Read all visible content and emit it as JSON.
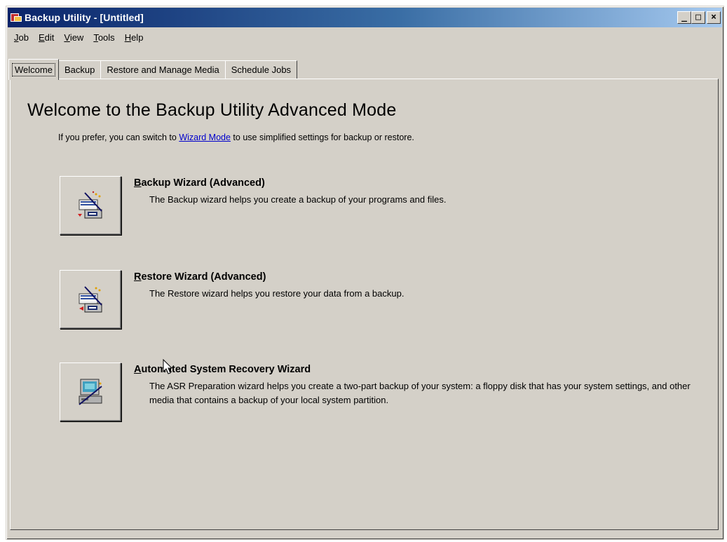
{
  "window": {
    "title": "Backup Utility - [Untitled]",
    "controls": {
      "minimize": "_",
      "maximize": "□",
      "close": "×"
    }
  },
  "menu": [
    {
      "key": "J",
      "rest": "ob"
    },
    {
      "key": "E",
      "rest": "dit"
    },
    {
      "key": "V",
      "rest": "iew"
    },
    {
      "key": "T",
      "rest": "ools"
    },
    {
      "key": "H",
      "rest": "elp"
    }
  ],
  "tabs": [
    "Welcome",
    "Backup",
    "Restore and Manage Media",
    "Schedule Jobs"
  ],
  "welcome": {
    "heading": "Welcome to the Backup Utility Advanced Mode",
    "subtitle_pre": "If you prefer, you can switch to ",
    "subtitle_link": "Wizard Mode",
    "subtitle_post": " to use simplified settings for backup or restore."
  },
  "wizards": [
    {
      "title_key": "B",
      "title_rest": "ackup Wizard (Advanced)",
      "description": "The Backup wizard helps you create a backup of your programs and files.",
      "icon": "backup-wizard-icon"
    },
    {
      "title_key": "R",
      "title_rest": "estore Wizard (Advanced)",
      "description": "The Restore wizard helps you restore your data from a backup.",
      "icon": "restore-wizard-icon"
    },
    {
      "title_key": "A",
      "title_rest": "utomated System Recovery Wizard",
      "description": "The ASR Preparation wizard helps you create a two-part backup of your system: a floppy disk that has your system settings, and other media that contains a backup of your local system partition.",
      "icon": "asr-wizard-icon"
    }
  ],
  "colors": {
    "titlebar_start": "#0a246a",
    "titlebar_end": "#a6caf0",
    "face": "#d4d0c8",
    "link": "#0000cc"
  }
}
